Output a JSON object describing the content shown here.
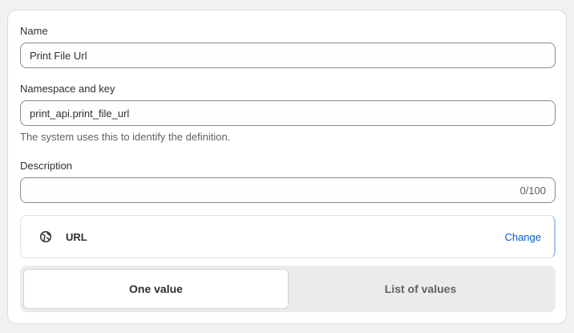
{
  "form": {
    "name": {
      "label": "Name",
      "value": "Print File Url"
    },
    "namespace": {
      "label": "Namespace and key",
      "value": "print_api.print_file_url",
      "help": "The system uses this to identify the definition."
    },
    "description": {
      "label": "Description",
      "value": "",
      "counter": "0/100"
    }
  },
  "type": {
    "icon": "globe-icon",
    "label": "URL",
    "change_label": "Change"
  },
  "value_mode": {
    "options": [
      "One value",
      "List of values"
    ],
    "selected": "One value"
  },
  "colors": {
    "link": "#005bd3",
    "border": "#8a8a8a",
    "background": "#f1f1f1"
  }
}
